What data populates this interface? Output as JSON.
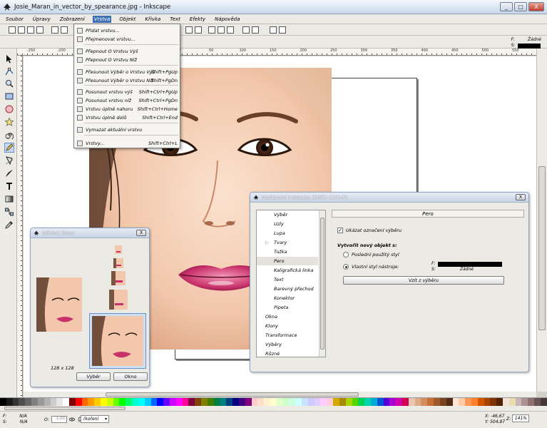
{
  "window": {
    "title": "Josie_Maran_in_vector_by_spearance.jpg - Inkscape",
    "minimize": "_",
    "maximize": "□",
    "close": "X"
  },
  "menu": [
    "Soubor",
    "Úpravy",
    "Zobrazení",
    "Vrstva",
    "Objekt",
    "Křivka",
    "Text",
    "Efekty",
    "Nápověda"
  ],
  "menu_active_index": 3,
  "layer_menu": {
    "items": [
      {
        "label": "Přidat vrstvu...",
        "shortcut": ""
      },
      {
        "label": "Přejmenovat vrstvu...",
        "shortcut": ""
      },
      {
        "label": "Přepnout O Vrstvu Výš",
        "shortcut": ""
      },
      {
        "label": "Přepnout O Vrstvu Níž",
        "shortcut": ""
      },
      {
        "label": "Přesunout Výběr o Vrstvu Výš",
        "shortcut": "Shift+PgUp"
      },
      {
        "label": "Přesunout Výběr o Vrstvu Níž",
        "shortcut": "Shift+PgDn"
      },
      {
        "label": "Posunout vrstvu výš",
        "shortcut": "Shift+Ctrl+PgUp"
      },
      {
        "label": "Posunout vrstvu níž",
        "shortcut": "Shift+Ctrl+PgDn"
      },
      {
        "label": "Vrstvu úplně nahoru",
        "shortcut": "Shift+Ctrl+Home"
      },
      {
        "label": "Vrstvu úplně dolů",
        "shortcut": "Shift+Ctrl+End"
      },
      {
        "label": "Vymazat aktuální vrstvu",
        "shortcut": ""
      },
      {
        "label": "Vrstvy...",
        "shortcut": "Shift+Ctrl+L"
      }
    ]
  },
  "style_indicator": {
    "fill_label": "F:",
    "fill_value": "Žádné",
    "stroke_label": "S:"
  },
  "ruler": {
    "labels": [
      "-250",
      "-200",
      "-150",
      "-100",
      "-50",
      "0",
      "50",
      "100",
      "150",
      "200",
      "250",
      "300",
      "350",
      "400",
      "450",
      "500",
      "550"
    ]
  },
  "icon_preview": {
    "title": "Náhled Ikony",
    "size_label": "128 x 128",
    "select_button": "Výběr",
    "window_button": "Okno"
  },
  "preferences": {
    "title": "Nastavení Inkscape (Shift+Ctrl+P)",
    "tree": [
      {
        "label": "Výběr",
        "indent": 1
      },
      {
        "label": "Uzly",
        "indent": 1
      },
      {
        "label": "Lupa",
        "indent": 1
      },
      {
        "label": "Tvary",
        "indent": 1,
        "expander": "▷"
      },
      {
        "label": "Tužka",
        "indent": 1
      },
      {
        "label": "Pero",
        "indent": 1,
        "selected": true
      },
      {
        "label": "Kaligrafická linka",
        "indent": 1
      },
      {
        "label": "Text",
        "indent": 1
      },
      {
        "label": "Barevný přechod",
        "indent": 1
      },
      {
        "label": "Konektor",
        "indent": 1
      },
      {
        "label": "Pipeta",
        "indent": 1
      },
      {
        "label": "Okna",
        "indent": 0
      },
      {
        "label": "Klony",
        "indent": 0
      },
      {
        "label": "Transformace",
        "indent": 0
      },
      {
        "label": "Výběry",
        "indent": 0
      },
      {
        "label": "Různé",
        "indent": 0
      }
    ],
    "panel_title": "Pero",
    "show_selection_cue": "Ukázat označení výběru",
    "create_new_label": "Vytvořit nový objekt s:",
    "last_used_style": "Poslední použitý styl",
    "own_tool_style": "Vlastní styl nástroje:",
    "preview_fill_label": "F:",
    "preview_stroke_label": "S:",
    "preview_stroke_value": "Žádné",
    "take_from_selection": "Vzít z výběru"
  },
  "status": {
    "fill_label": "F:",
    "fill_value": "N/A",
    "stroke_label": "S:",
    "stroke_value": "N/A",
    "opacity_label": "O:",
    "opacity_value": "1,00",
    "layer": "(kořen)",
    "x_label": "X:",
    "x_value": "-46,67",
    "y_label": "Y:",
    "y_value": "504,87",
    "zoom_label": "Z:",
    "zoom_value": "141%"
  },
  "colors": {
    "menu_highlight": "#3d6fb5",
    "accent": "#3d6fb5"
  }
}
